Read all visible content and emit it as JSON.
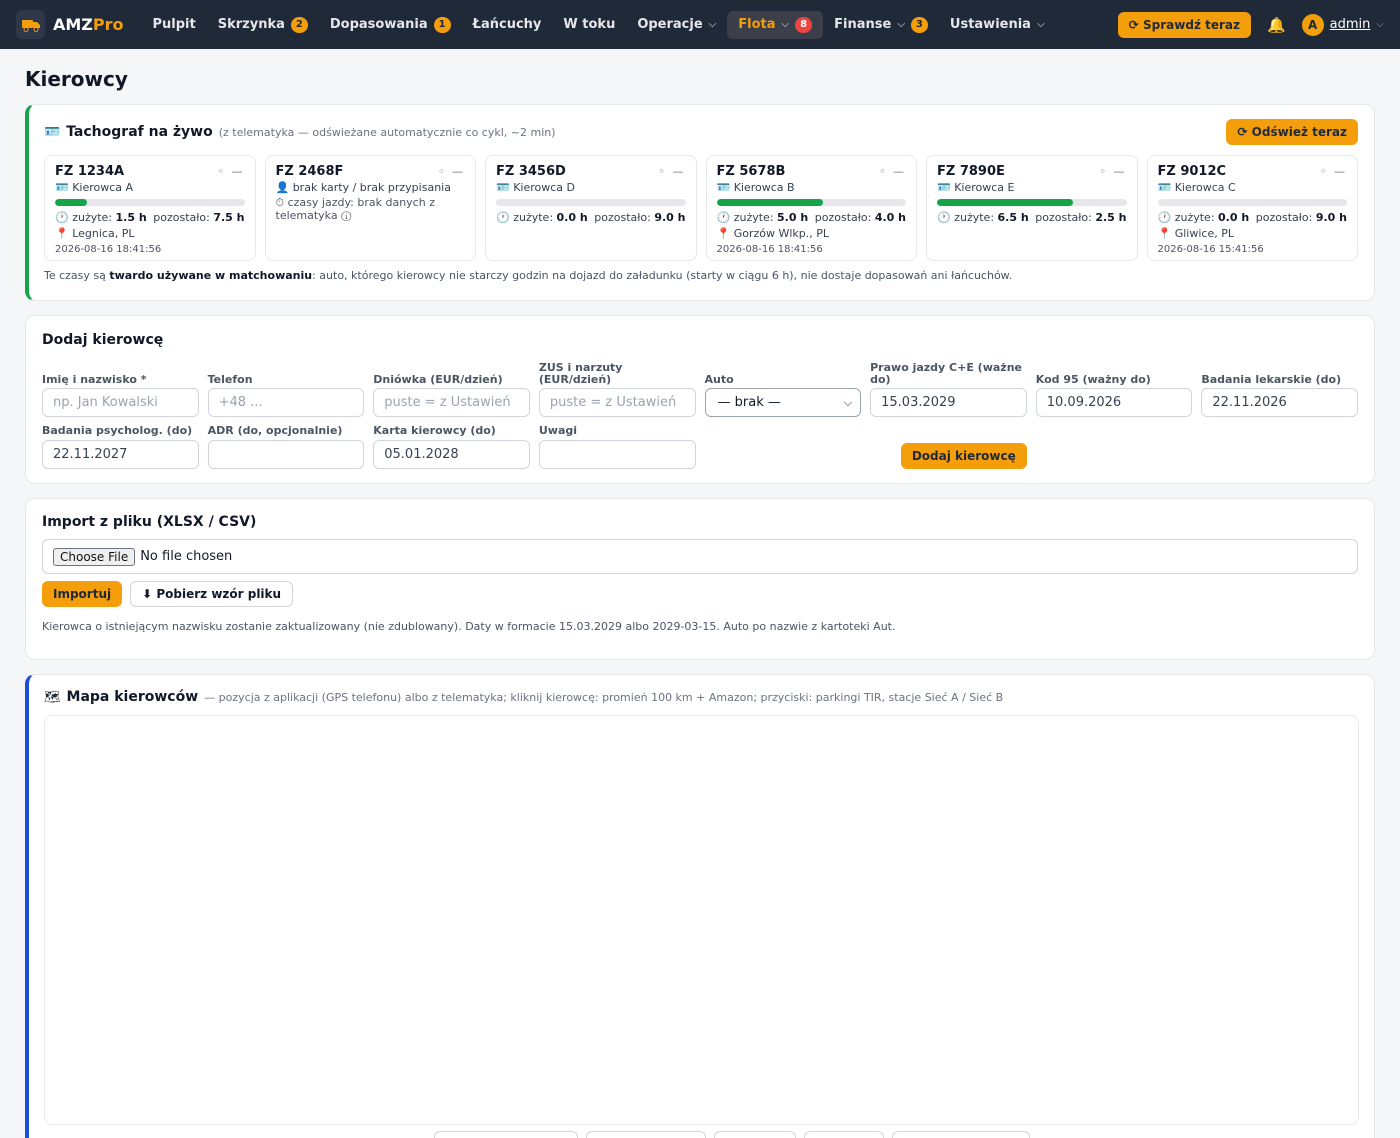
{
  "nav": {
    "logo_main": "AMZ",
    "logo_accent": "Pro",
    "items": [
      {
        "label": "Pulpit",
        "badge": ""
      },
      {
        "label": "Skrzynka",
        "badge": "2"
      },
      {
        "label": "Dopasowania",
        "badge": "1"
      },
      {
        "label": "Łańcuchy",
        "badge": ""
      },
      {
        "label": "W toku",
        "badge": ""
      },
      {
        "label": "Operacje",
        "badge": ""
      },
      {
        "label": "Flota",
        "badge": "8"
      },
      {
        "label": "Finanse",
        "badge": "3"
      },
      {
        "label": "Ustawienia",
        "badge": ""
      }
    ],
    "check_now": "⟳ Sprawdź teraz",
    "user_initial": "A",
    "user_name": "admin"
  },
  "page_title": "Kierowcy",
  "tacho": {
    "title": "Tachograf na żywo",
    "subtitle": "(z telematyka — odświeżane automatycznie co cykl, ~2 min)",
    "refresh": "⟳ Odśwież teraz",
    "used_label": "zużyte:",
    "left_label": "pozostało:",
    "cards": [
      {
        "plate": "FZ 1234A",
        "driver": "Kierowca A",
        "used": "1.5 h",
        "left": "7.5 h",
        "progress": 0.17,
        "location": "Legnica, PL",
        "time": "2026-08-16 18:41:56"
      },
      {
        "plate": "FZ 2468F",
        "driver": "brak karty / brak przypisania",
        "nodata": "czasy jazdy: brak danych z telematyka"
      },
      {
        "plate": "FZ 3456D",
        "driver": "Kierowca D",
        "used": "0.0 h",
        "left": "9.0 h",
        "progress": 0,
        "location": "",
        "time": ""
      },
      {
        "plate": "FZ 5678B",
        "driver": "Kierowca B",
        "used": "5.0 h",
        "left": "4.0 h",
        "progress": 0.56,
        "location": "Gorzów Wlkp., PL",
        "time": "2026-08-16 18:41:56"
      },
      {
        "plate": "FZ 7890E",
        "driver": "Kierowca E",
        "used": "6.5 h",
        "left": "2.5 h",
        "progress": 0.72,
        "location": "",
        "time": ""
      },
      {
        "plate": "FZ 9012C",
        "driver": "Kierowca C",
        "used": "0.0 h",
        "left": "9.0 h",
        "progress": 0,
        "location": "Gliwice, PL",
        "time": "2026-08-16 15:41:56"
      }
    ],
    "note_pre": "Te czasy są ",
    "note_bold": "twardo używane w matchowaniu",
    "note_post": ": auto, którego kierowcy nie starczy godzin na dojazd do załadunku (starty w ciągu 6 h), nie dostaje dopasowań ani łańcuchów."
  },
  "add_driver": {
    "title": "Dodaj kierowcę",
    "fields": {
      "name_label": "Imię i nazwisko *",
      "name_placeholder": "np. Jan Kowalski",
      "phone_label": "Telefon",
      "phone_placeholder": "+48 ...",
      "daily_label": "Dniówka (EUR/dzień)",
      "daily_placeholder": "puste = z Ustawień",
      "zus_label": "ZUS i narzuty (EUR/dzień)",
      "zus_placeholder": "puste = z Ustawień",
      "car_label": "Auto",
      "car_value": "— brak —",
      "license_label": "Prawo jazdy C+E (ważne do)",
      "license_value": "15.03.2029",
      "code95_label": "Kod 95 (ważny do)",
      "code95_value": "10.09.2026",
      "medical_label": "Badania lekarskie (do)",
      "medical_value": "22.11.2026",
      "psych_label": "Badania psycholog. (do)",
      "psych_value": "22.11.2027",
      "adr_label": "ADR (do, opcjonalnie)",
      "adr_value": "",
      "card_label": "Karta kierowcy (do)",
      "card_value": "05.01.2028",
      "notes_label": "Uwagi",
      "notes_value": ""
    },
    "submit": "Dodaj kierowcę"
  },
  "import": {
    "title": "Import z pliku (XLSX / CSV)",
    "choose": "Choose File",
    "no_file": "No file chosen",
    "import_btn": "Importuj",
    "template_btn": "⬇ Pobierz wzór pliku",
    "note": "Kierowca o istniejącym nazwisku zostanie zaktualizowany (nie zdublowany). Daty w formacie 15.03.2029 albo 2029-03-15. Auto po nazwie z kartoteki Aut."
  },
  "map": {
    "title": "Mapa kierowców",
    "subtitle": "— pozycja z aplikacji (GPS telefonu) albo z telematyka; kliknij kierowcę: promień 100 km + Amazon; przyciski: parkingi TIR, stacje Sieć A / Sieć B"
  },
  "colors": {
    "nav_bg": "#1f2937",
    "accent": "#f59e0b",
    "badge_red": "#ef4444",
    "tacho_border": "#16a34a",
    "progress": "#16a34a",
    "map_border": "#1d4ed8"
  },
  "icons": {
    "logo": "truck-icon",
    "bell": "bell-icon",
    "card": "id-card-icon",
    "person": "person-icon",
    "clock": "clock-icon",
    "pin": "pin-icon",
    "map": "map-icon"
  }
}
